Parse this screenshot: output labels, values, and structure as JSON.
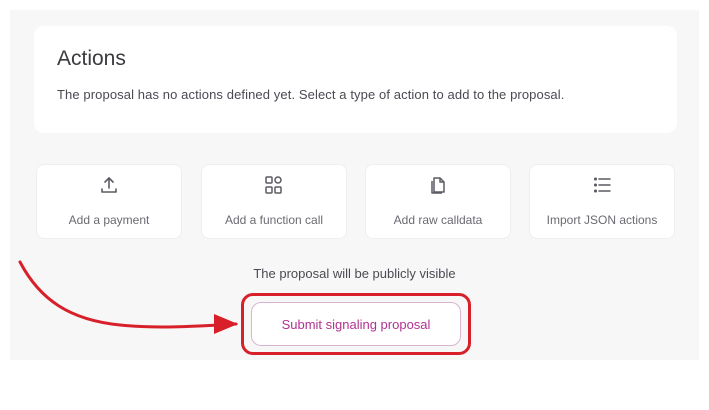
{
  "actions": {
    "title": "Actions",
    "description": "The proposal has no actions defined yet. Select a type of action to add to the proposal."
  },
  "tiles": [
    {
      "label": "Add a payment",
      "icon": "upload-icon"
    },
    {
      "label": "Add a function call",
      "icon": "function-blocks-icon"
    },
    {
      "label": "Add raw calldata",
      "icon": "copy-icon"
    },
    {
      "label": "Import JSON actions",
      "icon": "list-icon"
    }
  ],
  "visibility_note": "The proposal will be publicly visible",
  "submit_label": "Submit signaling proposal",
  "colors": {
    "accent": "#b0328f",
    "annotation_red": "#d7202a",
    "panel_bg": "#f7f7f8"
  }
}
